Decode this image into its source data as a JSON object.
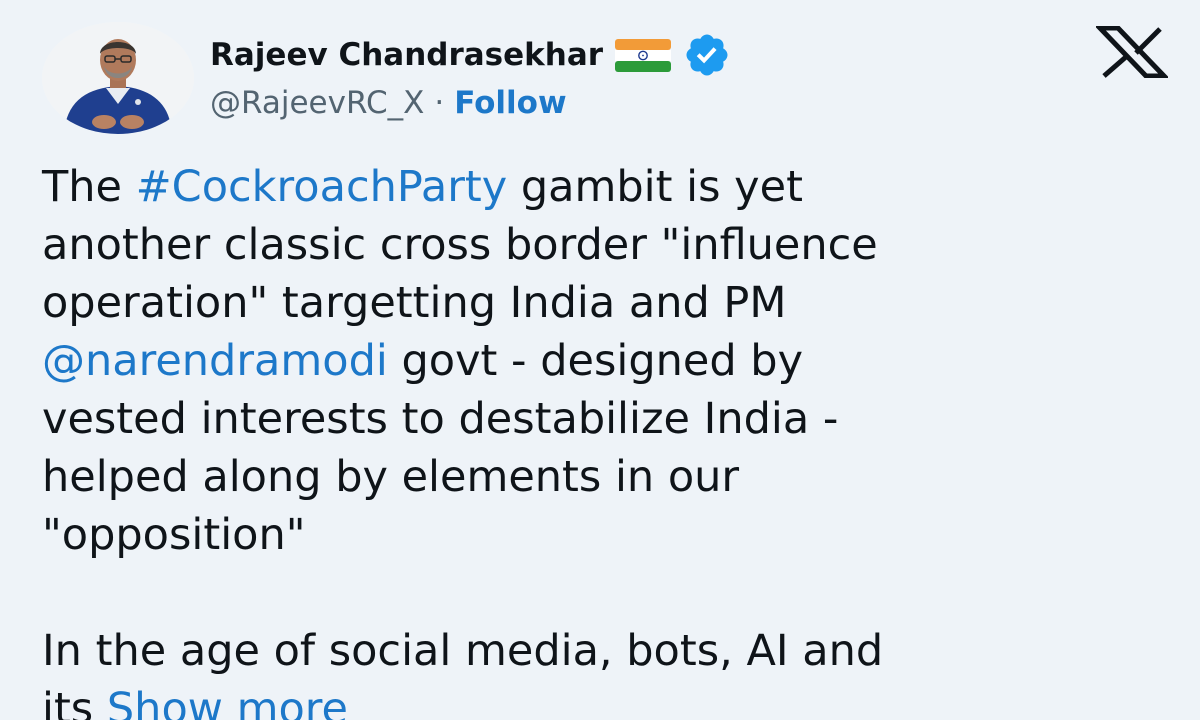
{
  "author": {
    "display_name": "Rajeev Chandrasekhar",
    "handle": "@RajeevRC_X",
    "separator": "·",
    "follow_label": "Follow",
    "flag_icon": "india-flag-icon",
    "verified_icon": "verified-badge-icon",
    "verified_color": "#1d9bf0"
  },
  "platform": {
    "logo": "x-logo-icon"
  },
  "tweet": {
    "line1_pre": "The ",
    "line1_hashtag": "#CockroachParty",
    "line1_post": " gambit is yet",
    "line2": "another classic cross border \"influence",
    "line3": "operation\" targetting India and PM",
    "line4_mention": "@narendramodi",
    "line4_post": " govt - designed by",
    "line5": "vested interests to destabilize India -",
    "line6": "helped along by elements in our",
    "line7": "\"opposition\"",
    "line8": "In the age of social media, bots, AI and",
    "line9_pre": "its ",
    "show_more": "Show more"
  },
  "colors": {
    "background": "#eef3f8",
    "text": "#0f1419",
    "secondary": "#536471",
    "link": "#1d78c9"
  }
}
